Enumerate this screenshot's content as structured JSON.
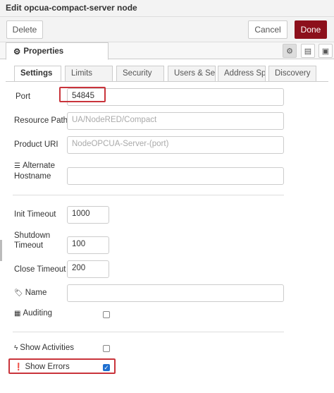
{
  "window": {
    "title": "Edit opcua-compact-server node"
  },
  "toolbar": {
    "delete_label": "Delete",
    "cancel_label": "Cancel",
    "done_label": "Done"
  },
  "properties": {
    "tab_label": "Properties"
  },
  "tabs": [
    {
      "label": "Settings",
      "active": true
    },
    {
      "label": "Limits",
      "active": false
    },
    {
      "label": "Security",
      "active": false
    },
    {
      "label": "Users & Sets",
      "active": false
    },
    {
      "label": "Address Sp",
      "active": false
    },
    {
      "label": "Discovery",
      "active": false
    }
  ],
  "form": {
    "port": {
      "label": "Port",
      "value": "54845"
    },
    "resource_path": {
      "label": "Resource Path",
      "placeholder": "UA/NodeRED/Compact"
    },
    "product_uri": {
      "label": "Product URI",
      "placeholder": "NodeOPCUA-Server-(port)"
    },
    "alternate_hostname": {
      "label_line1": "Alternate",
      "label_line2": "Hostname",
      "value": ""
    },
    "init_timeout": {
      "label": "Init Timeout",
      "value": "1000"
    },
    "shutdown_timeout": {
      "label_line1": "Shutdown",
      "label_line2": "Timeout",
      "value": "100"
    },
    "close_timeout": {
      "label": "Close Timeout",
      "value": "200"
    },
    "name": {
      "label": "Name",
      "value": ""
    },
    "auditing": {
      "label": "Auditing",
      "checked": false
    },
    "show_activities": {
      "label": "Show Activities",
      "checked": false
    },
    "show_errors": {
      "label": "Show Errors",
      "checked": true
    }
  },
  "colors": {
    "done_button": "#8c101c",
    "highlight": "#c9343b",
    "checkbox_checked": "#1e6fd0"
  }
}
